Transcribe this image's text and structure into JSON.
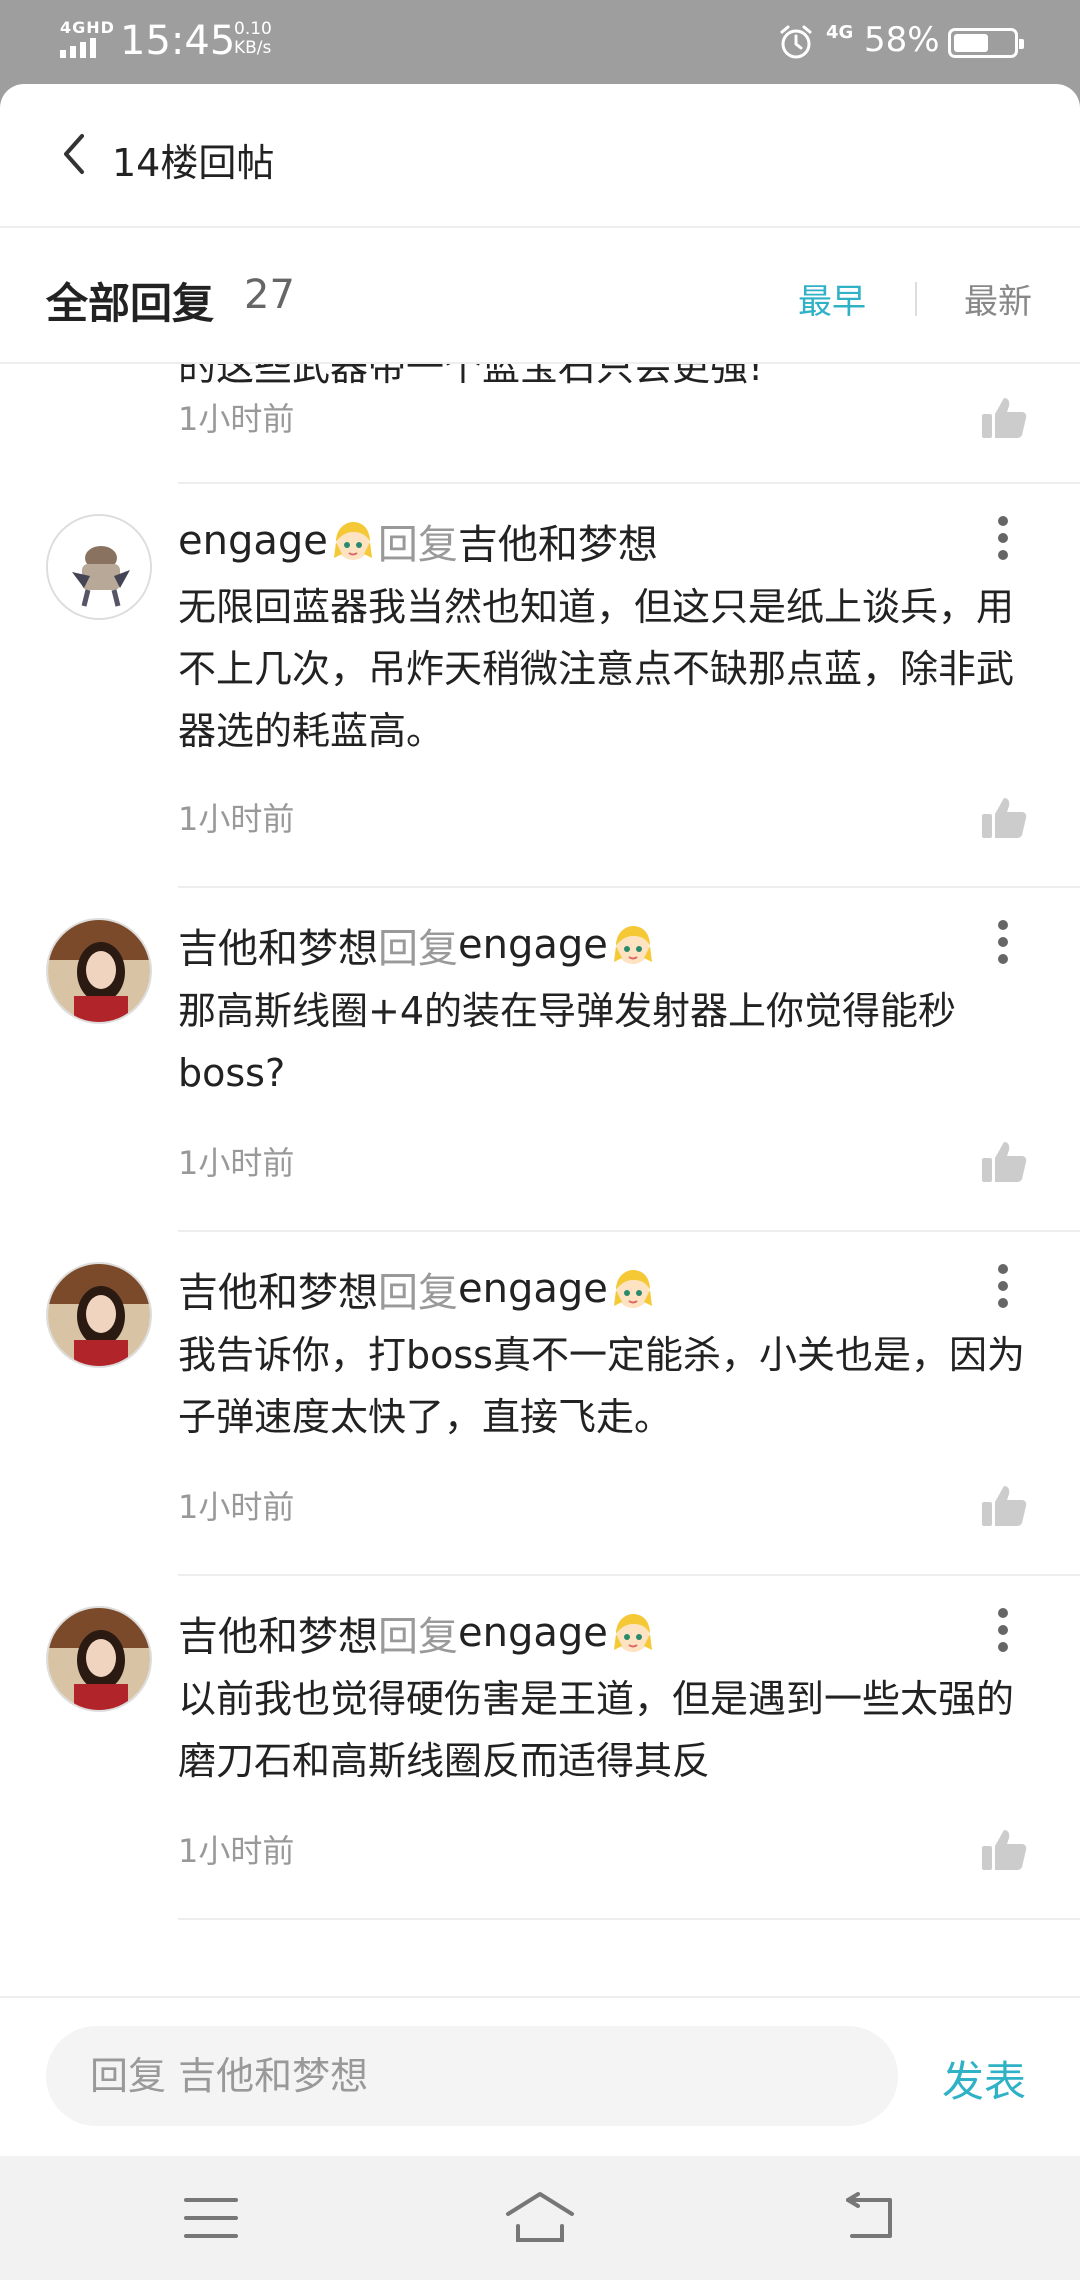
{
  "status_bar": {
    "network": "4GHD",
    "time": "15:45",
    "speed_value": "0.10",
    "speed_unit": "KB/s",
    "mobile": "4G",
    "battery": "58%",
    "battery_level": 0.58
  },
  "header": {
    "title": "14楼回帖"
  },
  "reply_header": {
    "label": "全部回复",
    "count": "27",
    "sort_earliest": "最早",
    "sort_newest": "最新",
    "active_color": "#2fb1c6"
  },
  "partial_reply": {
    "text": "的这些武器带一个蓝宝石只会更强!",
    "time": "1小时前"
  },
  "replies": [
    {
      "author": "engage",
      "reply_word": "回复",
      "target": "吉他和梦想",
      "content": "无限回蓝器我当然也知道，但这只是纸上谈兵，用不上几次，吊炸天稍微注意点不缺那点蓝，除非武器选的耗蓝高。",
      "time": "1小时前"
    },
    {
      "author": "吉他和梦想",
      "reply_word": "回复",
      "target": "engage",
      "content": "那高斯线圈+4的装在导弹发射器上你觉得能秒boss?",
      "time": "1小时前"
    },
    {
      "author": "吉他和梦想",
      "reply_word": "回复",
      "target": "engage",
      "content": "我告诉你，打boss真不一定能杀，小关也是，因为子弹速度太快了，直接飞走。",
      "time": "1小时前"
    },
    {
      "author": "吉他和梦想",
      "reply_word": "回复",
      "target": "engage",
      "content": "以前我也觉得硬伤害是王道，但是遇到一些太强的磨刀石和高斯线圈反而适得其反",
      "time": "1小时前"
    }
  ],
  "input": {
    "placeholder": "回复 吉他和梦想",
    "send_label": "发表"
  }
}
